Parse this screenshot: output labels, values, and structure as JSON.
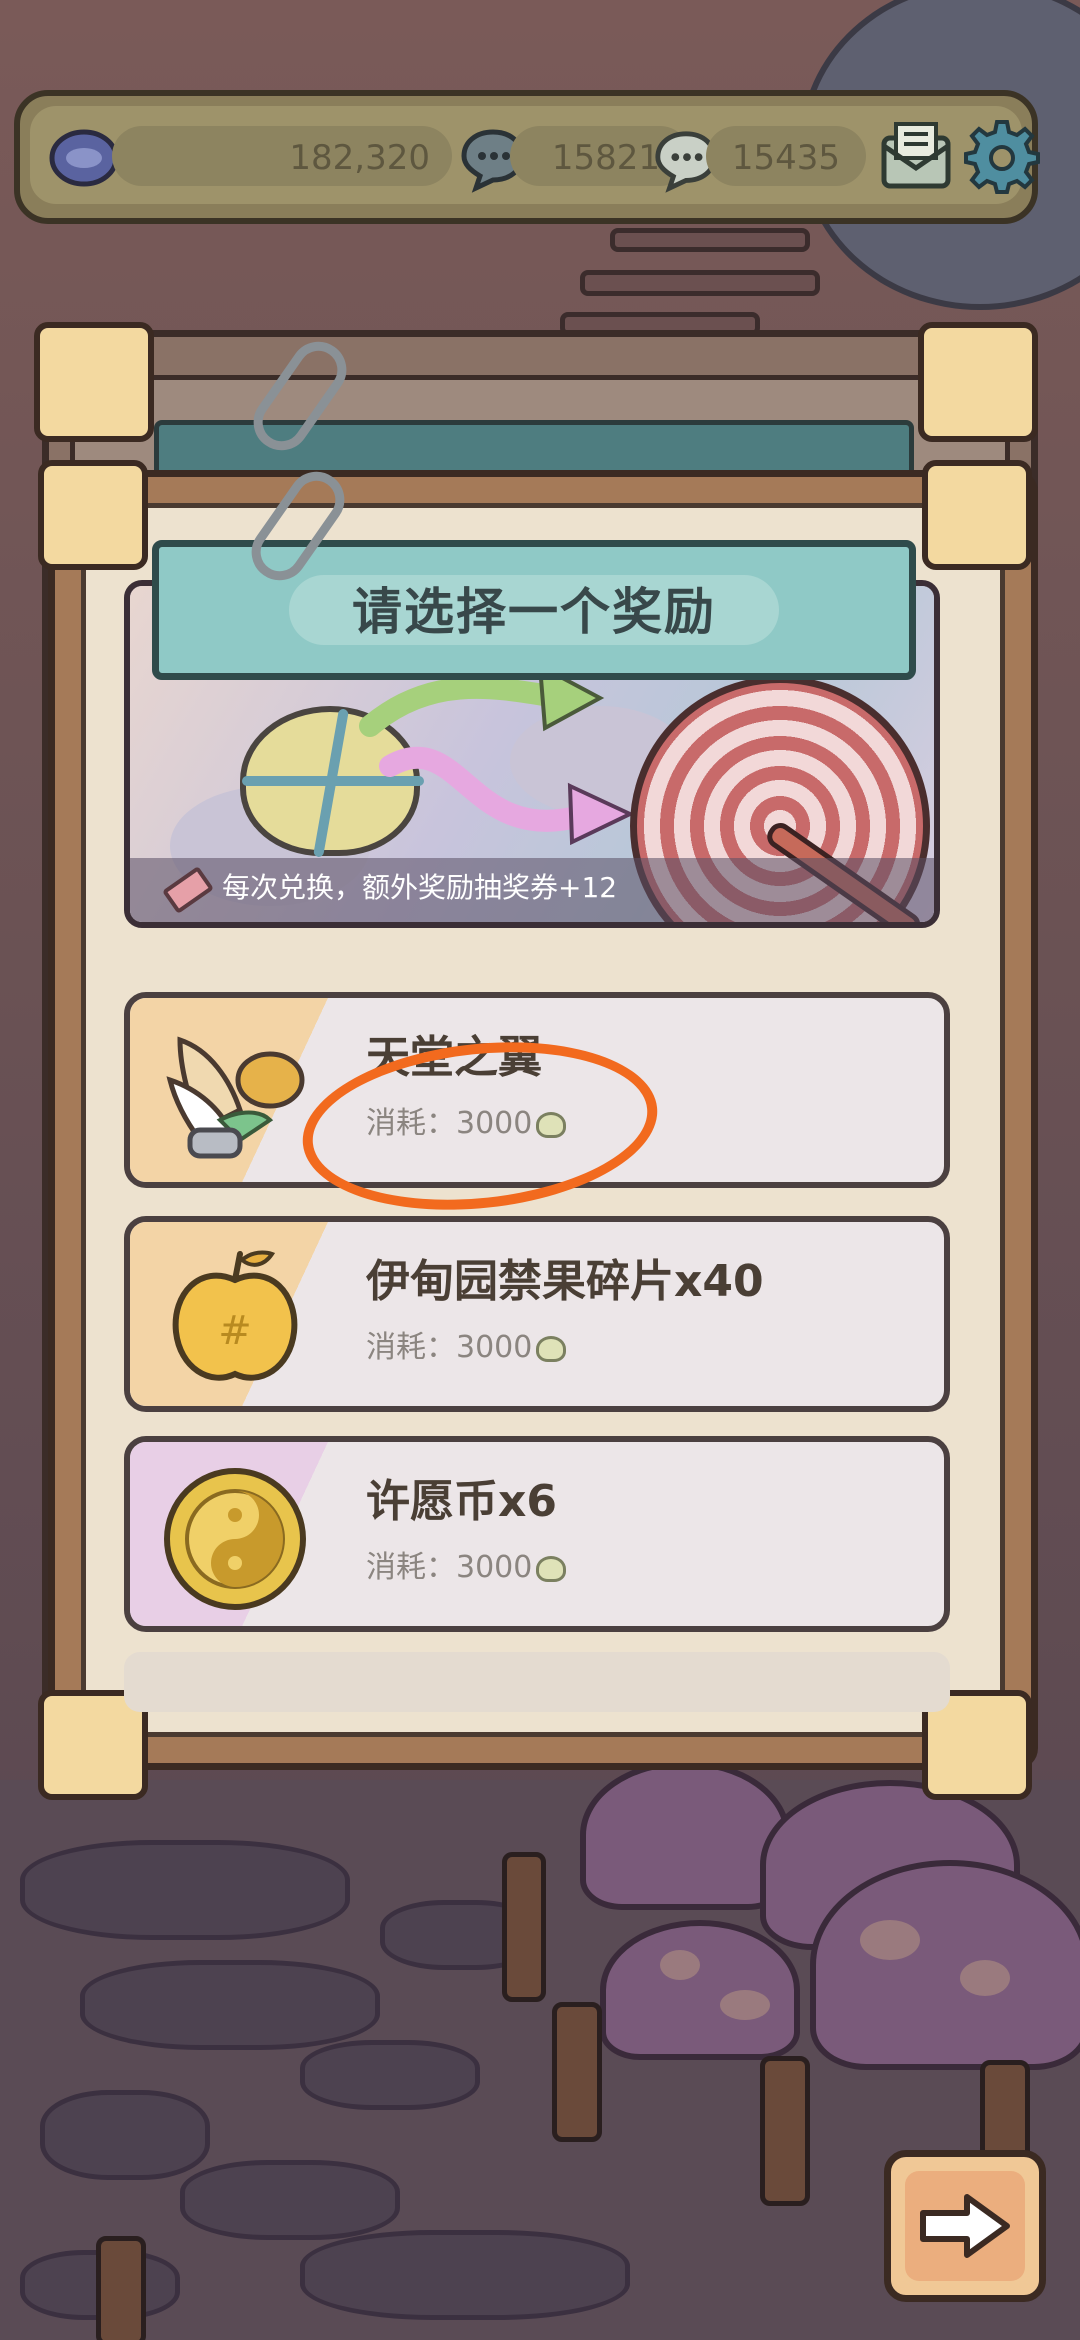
{
  "topbar": {
    "gold": "182,320",
    "chat_a": "15821",
    "chat_b": "15435",
    "icons": [
      "gold-coin-icon",
      "speech-bubble-icon",
      "speech-bubble-icon",
      "mail-icon",
      "gear-icon"
    ]
  },
  "dialog": {
    "title": "请选择一个奖励",
    "banner_text": "每次兑换，额外奖励抽奖券+12",
    "rewards": [
      {
        "name": "天堂之翼",
        "cost_label": "消耗：",
        "cost_value": "3000",
        "icon": "wing-icon",
        "tint": "#f3d4a6"
      },
      {
        "name": "伊甸园禁果碎片x40",
        "cost_label": "消耗：",
        "cost_value": "3000",
        "icon": "golden-apple-icon",
        "tint": "#f3d4a6"
      },
      {
        "name": "许愿币x6",
        "cost_label": "消耗：",
        "cost_value": "3000",
        "icon": "wish-coin-icon",
        "tint": "#e8cfe6"
      }
    ]
  },
  "colors": {
    "annotation": "#f26a1e",
    "panel_frame": "#a57a58",
    "title_plate": "#8fc9c6"
  }
}
